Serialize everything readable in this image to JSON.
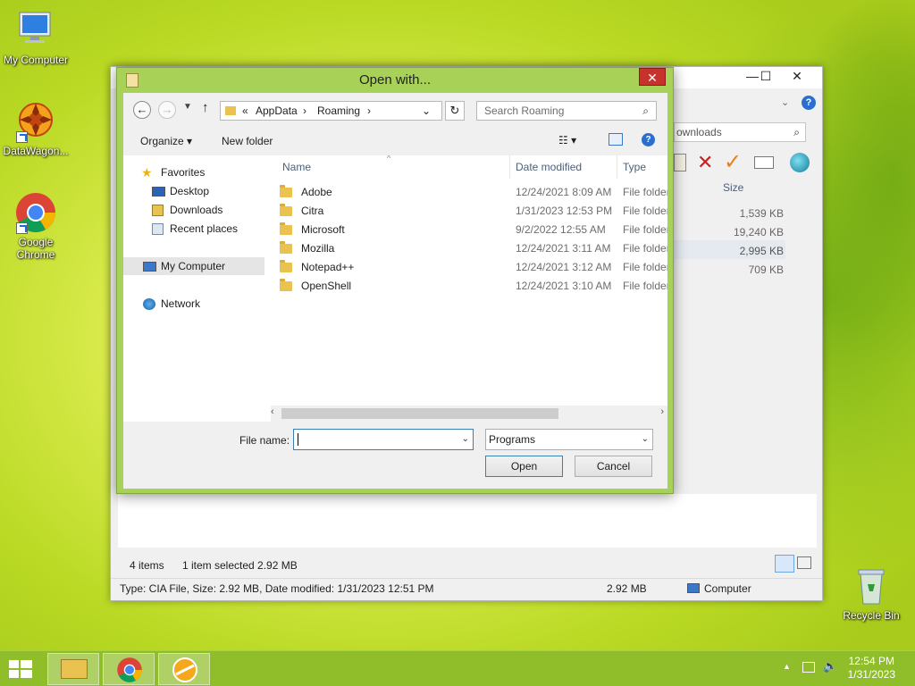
{
  "desktop": {
    "icons": [
      {
        "label": "My Computer"
      },
      {
        "label": "DataWagon..."
      },
      {
        "label": "Google Chrome"
      },
      {
        "label": "Recycle Bin"
      }
    ]
  },
  "background_window": {
    "search_text": "ownloads",
    "size_header": "Size",
    "sizes": [
      "1,539 KB",
      "19,240 KB",
      "2,995 KB",
      "709 KB"
    ],
    "status_items": "4 items",
    "status_selected": "1 item selected  2.92 MB",
    "detail_text": "Type: CIA File, Size: 2.92 MB, Date modified: 1/31/2023 12:51 PM",
    "detail_size": "2.92 MB",
    "detail_location": "Computer"
  },
  "dialog": {
    "title": "Open with...",
    "breadcrumb": [
      "«",
      "AppData",
      "Roaming"
    ],
    "search_placeholder": "Search Roaming",
    "toolbar": {
      "organize": "Organize ▾",
      "new_folder": "New folder"
    },
    "nav": {
      "favorites": "Favorites",
      "desktop": "Desktop",
      "downloads": "Downloads",
      "recent": "Recent places",
      "my_computer": "My Computer",
      "network": "Network"
    },
    "columns": {
      "name": "Name",
      "date": "Date modified",
      "type": "Type"
    },
    "files": [
      {
        "name": "Adobe",
        "date": "12/24/2021 8:09 AM",
        "type": "File folder"
      },
      {
        "name": "Citra",
        "date": "1/31/2023 12:53 PM",
        "type": "File folder"
      },
      {
        "name": "Microsoft",
        "date": "9/2/2022 12:55 AM",
        "type": "File folder"
      },
      {
        "name": "Mozilla",
        "date": "12/24/2021 3:11 AM",
        "type": "File folder"
      },
      {
        "name": "Notepad++",
        "date": "12/24/2021 3:12 AM",
        "type": "File folder"
      },
      {
        "name": "OpenShell",
        "date": "12/24/2021 3:10 AM",
        "type": "File folder"
      }
    ],
    "file_name_label": "File name:",
    "file_name_value": "",
    "file_type_value": "Programs",
    "open_label": "Open",
    "cancel_label": "Cancel"
  },
  "taskbar": {
    "time": "12:54 PM",
    "date": "1/31/2023"
  },
  "colors": {
    "dialog_frame": "#a7d257",
    "close_red": "#c7322c",
    "taskbar": "#8fbe2a"
  }
}
